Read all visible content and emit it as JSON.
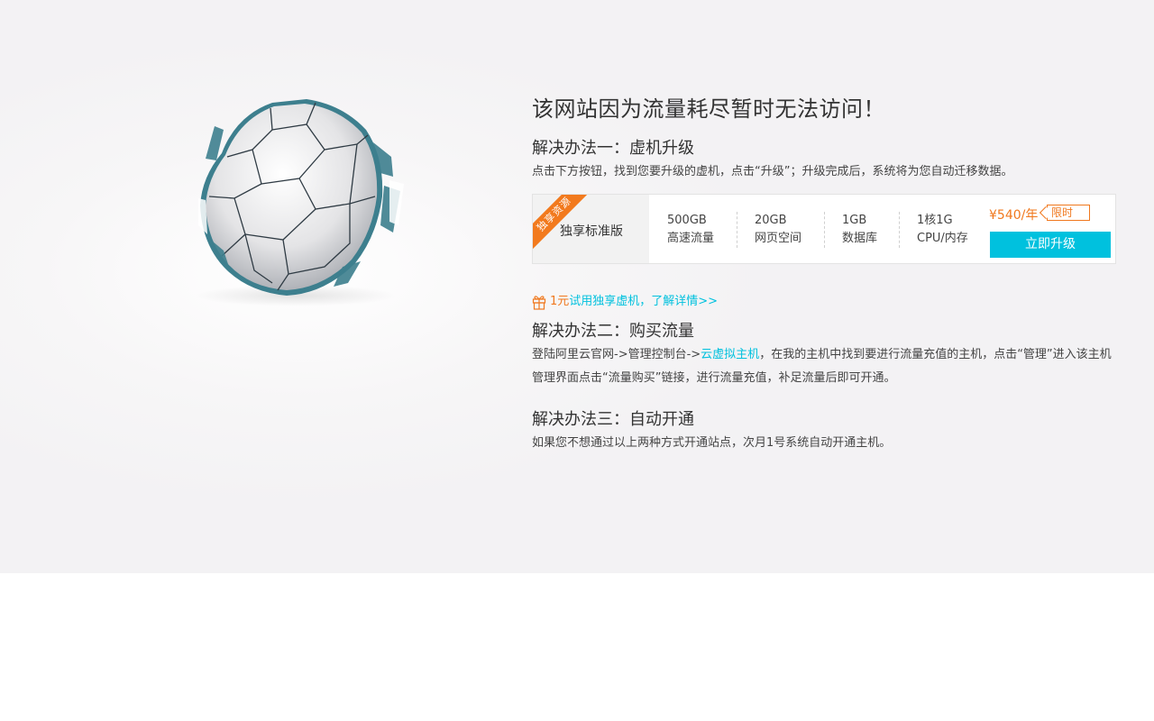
{
  "main_title": "该网站因为流量耗尽暂时无法访问！",
  "solution1": {
    "title": "解决办法一：虚机升级",
    "desc": "点击下方按钮，找到您要升级的虚机，点击“升级”；升级完成后，系统将为您自动迁移数据。"
  },
  "plan": {
    "ribbon": "独享资源",
    "name": "独享标准版",
    "specs": [
      {
        "value": "500GB",
        "label": "高速流量"
      },
      {
        "value": "20GB",
        "label": "网页空间"
      },
      {
        "value": "1GB",
        "label": "数据库"
      },
      {
        "value": "1核1G",
        "label": "CPU/内存"
      }
    ],
    "price": "¥540/年",
    "tag": "限时",
    "button": "立即升级"
  },
  "trial": {
    "highlight": "1元",
    "link": "试用独享虚机，了解详情>>"
  },
  "solution2": {
    "title": "解决办法二：购买流量",
    "desc_part1": "登陆阿里云官网->管理控制台->",
    "desc_link": "云虚拟主机",
    "desc_part2": "，在我的主机中找到要进行流量充值的主机，点击“管理”进入该主机管理界面点击“流量购买”链接，进行流量充值，补足流量后即可开通。"
  },
  "solution3": {
    "title": "解决办法三：自动开通",
    "desc": "如果您不想通过以上两种方式开通站点，次月1号系统自动开通主机。"
  },
  "colors": {
    "accent": "#00c1de",
    "orange": "#f0781e",
    "ribbon": "#f27a1e"
  }
}
